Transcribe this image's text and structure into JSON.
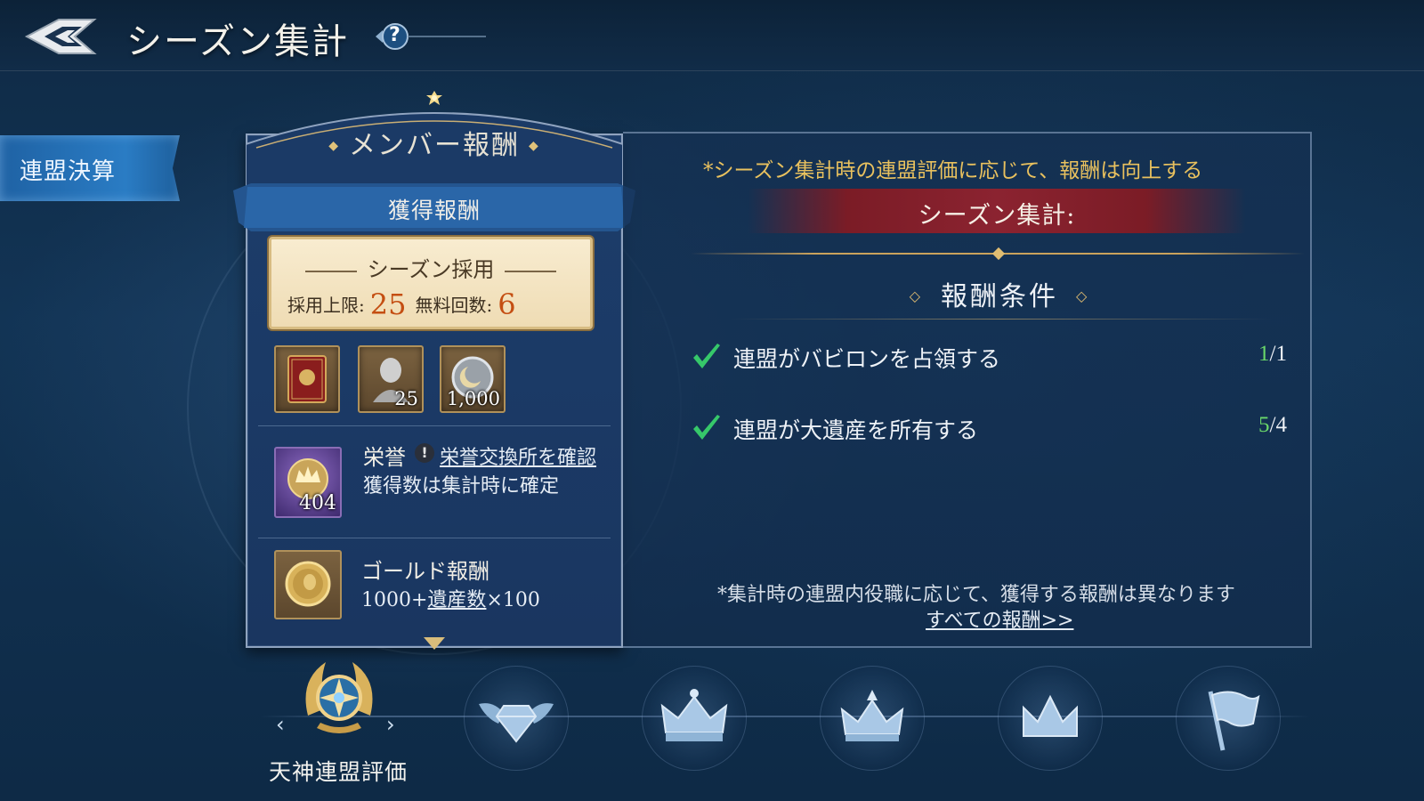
{
  "header": {
    "title": "シーズン集計",
    "help_label": "?"
  },
  "sidebar": {
    "items": [
      {
        "label": "連盟決算",
        "active": true
      }
    ]
  },
  "reward_card": {
    "title": "メンバー報酬",
    "ribbon_label": "獲得報酬",
    "season_recruit": {
      "title": "シーズン採用",
      "limit_label": "採用上限:",
      "limit_value": "25",
      "free_label": "無料回数:",
      "free_value": "6"
    },
    "items": [
      {
        "icon": "red-book-icon",
        "count": ""
      },
      {
        "icon": "hero-bust-icon",
        "count": "25"
      },
      {
        "icon": "moon-medal-icon",
        "count": "1,000"
      }
    ],
    "honor": {
      "icon": "crown-medal-icon",
      "count": "404",
      "title": "栄誉",
      "warn": "!",
      "link": "栄誉交換所を確認",
      "sub": "獲得数は集計時に確定"
    },
    "gold": {
      "icon": "gold-coin-icon",
      "title": "ゴールド報酬",
      "formula_prefix": "1000+",
      "formula_link": "遺産数",
      "formula_suffix": "×100"
    }
  },
  "right_panel": {
    "notice": "*シーズン集計時の連盟評価に応じて、報酬は向上する",
    "banner": "シーズン集計:",
    "conditions_title": "報酬条件",
    "conditions": [
      {
        "text": "連盟がバビロンを占領する",
        "current": "1",
        "required": "/1",
        "done": true
      },
      {
        "text": "連盟が大遺産を所有する",
        "current": "5",
        "required": "/4",
        "done": true
      }
    ],
    "footnote": "*集計時の連盟内役職に応じて、獲得する報酬は異なります",
    "all_rewards_link": "すべての報酬>>"
  },
  "ranks": {
    "selected_label": "天神連盟評価",
    "prev_arrow": "‹",
    "next_arrow": "›",
    "emblems": [
      "celestial-emblem-icon",
      "winged-diamond-icon",
      "jeweled-crown-icon",
      "ornate-crown-icon",
      "simple-crown-icon",
      "banner-flag-icon"
    ]
  },
  "colors": {
    "accent_gold": "#e9c15e",
    "progress_green": "#6ad86a",
    "banner_red": "#8b2330",
    "sidebar_blue": "#2a7cc4"
  }
}
